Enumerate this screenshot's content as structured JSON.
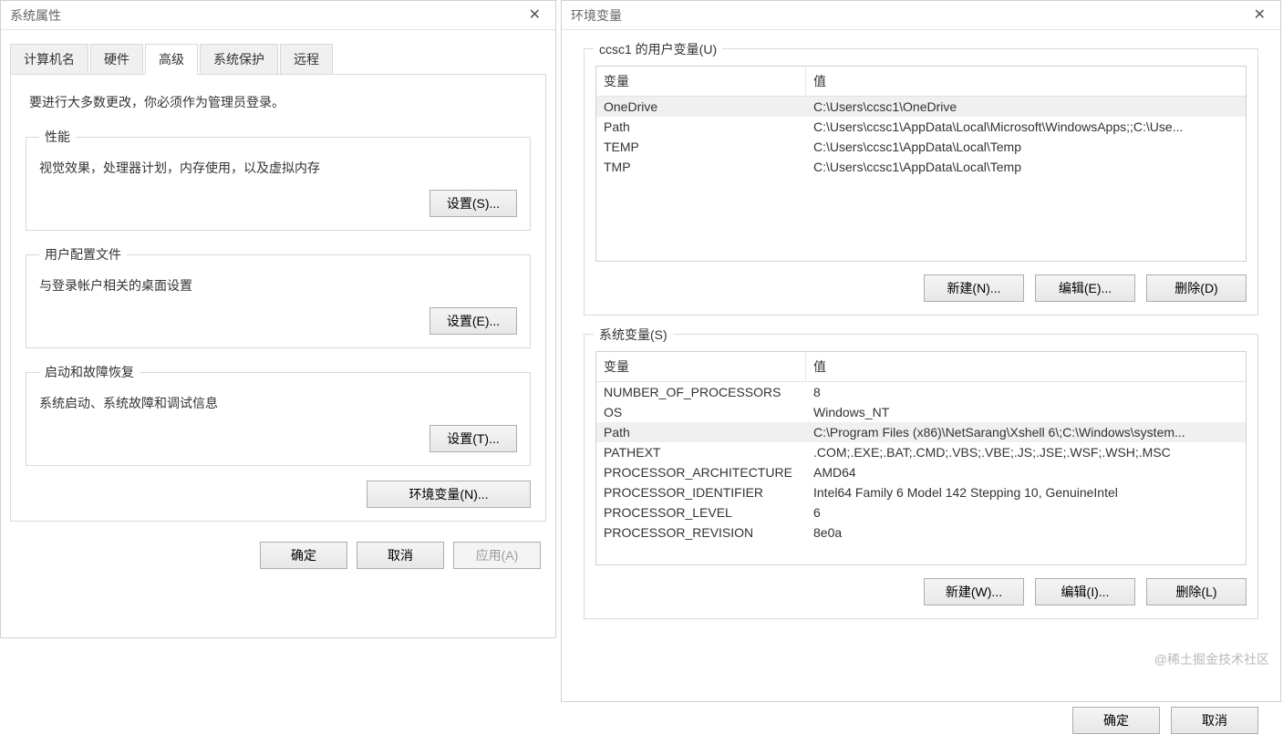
{
  "left": {
    "title": "系统属性",
    "tabs": [
      "计算机名",
      "硬件",
      "高级",
      "系统保护",
      "远程"
    ],
    "active_tab_index": 2,
    "admin_note": "要进行大多数更改，你必须作为管理员登录。",
    "perf": {
      "legend": "性能",
      "desc": "视觉效果，处理器计划，内存使用，以及虚拟内存",
      "btn": "设置(S)..."
    },
    "profiles": {
      "legend": "用户配置文件",
      "desc": "与登录帐户相关的桌面设置",
      "btn": "设置(E)..."
    },
    "startup": {
      "legend": "启动和故障恢复",
      "desc": "系统启动、系统故障和调试信息",
      "btn": "设置(T)..."
    },
    "env_btn": "环境变量(N)...",
    "ok": "确定",
    "cancel": "取消",
    "apply": "应用(A)"
  },
  "right": {
    "title": "环境变量",
    "user_group_label": "ccsc1 的用户变量(U)",
    "sys_group_label": "系统变量(S)",
    "col_name": "变量",
    "col_value": "值",
    "user_vars": [
      {
        "name": "OneDrive",
        "value": "C:\\Users\\ccsc1\\OneDrive",
        "selected": true
      },
      {
        "name": "Path",
        "value": "C:\\Users\\ccsc1\\AppData\\Local\\Microsoft\\WindowsApps;;C:\\Use..."
      },
      {
        "name": "TEMP",
        "value": "C:\\Users\\ccsc1\\AppData\\Local\\Temp"
      },
      {
        "name": "TMP",
        "value": "C:\\Users\\ccsc1\\AppData\\Local\\Temp"
      }
    ],
    "sys_vars": [
      {
        "name": "NUMBER_OF_PROCESSORS",
        "value": "8"
      },
      {
        "name": "OS",
        "value": "Windows_NT"
      },
      {
        "name": "Path",
        "value": "C:\\Program Files (x86)\\NetSarang\\Xshell 6\\;C:\\Windows\\system...",
        "selected": true
      },
      {
        "name": "PATHEXT",
        "value": ".COM;.EXE;.BAT;.CMD;.VBS;.VBE;.JS;.JSE;.WSF;.WSH;.MSC"
      },
      {
        "name": "PROCESSOR_ARCHITECTURE",
        "value": "AMD64"
      },
      {
        "name": "PROCESSOR_IDENTIFIER",
        "value": "Intel64 Family 6 Model 142 Stepping 10, GenuineIntel"
      },
      {
        "name": "PROCESSOR_LEVEL",
        "value": "6"
      },
      {
        "name": "PROCESSOR_REVISION",
        "value": "8e0a"
      }
    ],
    "user_btns": {
      "new": "新建(N)...",
      "edit": "编辑(E)...",
      "del": "删除(D)"
    },
    "sys_btns": {
      "new": "新建(W)...",
      "edit": "编辑(I)...",
      "del": "删除(L)"
    },
    "ok": "确定",
    "cancel": "取消"
  },
  "watermark": "@稀土掘金技术社区"
}
